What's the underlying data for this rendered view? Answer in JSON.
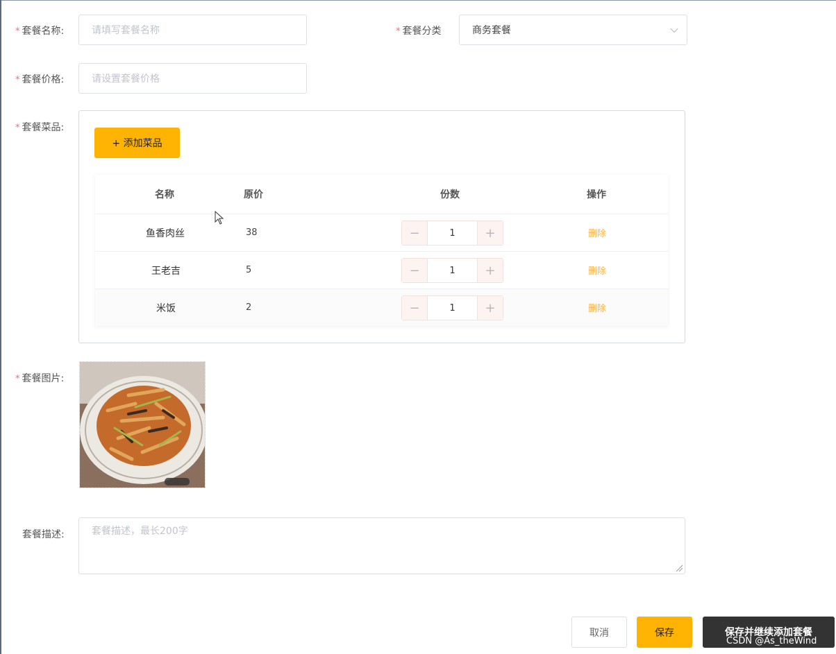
{
  "form": {
    "name": {
      "label": "套餐名称:",
      "placeholder": "请填写套餐名称"
    },
    "category": {
      "label": "套餐分类",
      "value": "商务套餐"
    },
    "price": {
      "label": "套餐价格:",
      "placeholder": "请设置套餐价格"
    },
    "dishes": {
      "label": "套餐菜品:",
      "add_button": "+ 添加菜品",
      "columns": [
        "名称",
        "原价",
        "份数",
        "操作"
      ],
      "rows": [
        {
          "name": "鱼香肉丝",
          "price": "38",
          "qty": "1",
          "action": "删除"
        },
        {
          "name": "王老吉",
          "price": "5",
          "qty": "1",
          "action": "删除"
        },
        {
          "name": "米饭",
          "price": "2",
          "qty": "1",
          "action": "删除"
        }
      ]
    },
    "image": {
      "label": "套餐图片:"
    },
    "description": {
      "label": "套餐描述:",
      "placeholder": "套餐描述，最长200字"
    },
    "required_mark": "*"
  },
  "actions": {
    "cancel": "取消",
    "save": "保存",
    "save_continue": "保存并继续添加套餐"
  },
  "watermark": "CSDN @As_theWind",
  "colors": {
    "accent": "#ffb302",
    "required": "#f56c6c",
    "delete_link": "#f5b54a"
  }
}
